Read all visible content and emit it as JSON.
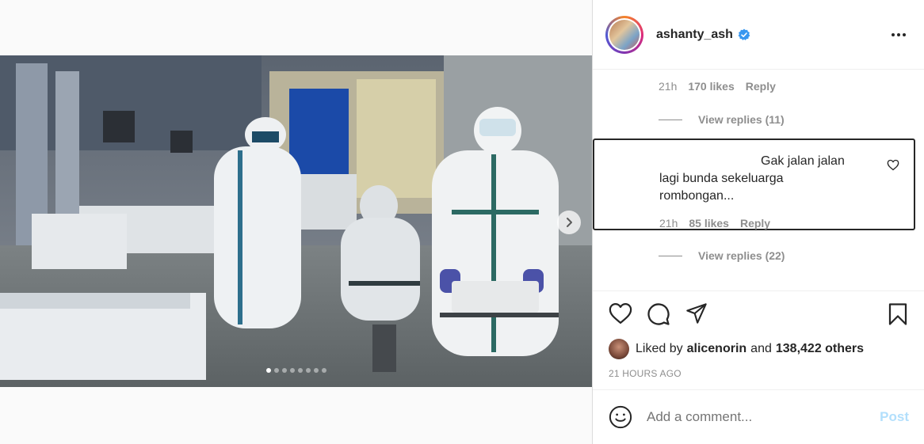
{
  "post": {
    "username": "ashanty_ash",
    "carousel": {
      "total": 8,
      "active_index": 0
    }
  },
  "comments": {
    "first": {
      "time": "21h",
      "likes": "170 likes",
      "reply_label": "Reply",
      "view_replies": "View replies (11)"
    },
    "highlighted": {
      "text_line1": "Gak jalan jalan",
      "text_rest": "lagi bunda sekeluarga rombongan...",
      "time": "21h",
      "likes": "85 likes",
      "reply_label": "Reply",
      "view_replies": "View replies (22)"
    }
  },
  "likes": {
    "prefix": "Liked by",
    "user": "alicenorin",
    "conjunction": "and",
    "others": "138,422 others"
  },
  "timestamp": "21 HOURS AGO",
  "add_comment": {
    "placeholder": "Add a comment...",
    "post_label": "Post"
  },
  "colors": {
    "verified": "#3897f0",
    "post_disabled": "#b2dffc",
    "muted": "#8e8e8e"
  },
  "icons": [
    "carousel-next-icon",
    "verified-badge-icon",
    "more-options-icon",
    "like-icon",
    "comment-icon",
    "share-icon",
    "save-icon",
    "emoji-icon",
    "comment-like-icon"
  ]
}
